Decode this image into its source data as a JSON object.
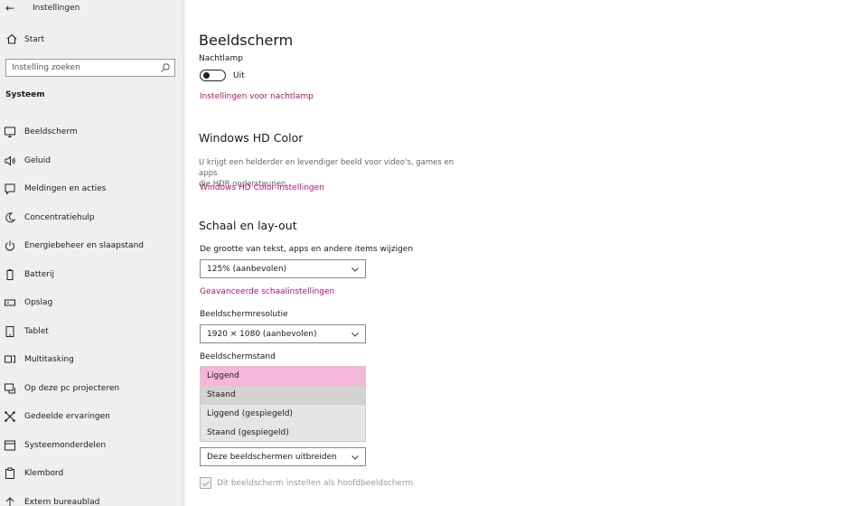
{
  "window": {
    "title": "Instellingen"
  },
  "sidebar": {
    "home_label": "Start",
    "search_placeholder": "Instelling zoeken",
    "section": "Systeem",
    "items": [
      {
        "label": "Beeldscherm",
        "icon": "monitor-icon"
      },
      {
        "label": "Geluid",
        "icon": "speaker-icon"
      },
      {
        "label": "Meldingen en acties",
        "icon": "notification-icon"
      },
      {
        "label": "Concentratiehulp",
        "icon": "moon-icon"
      },
      {
        "label": "Energiebeheer en slaapstand",
        "icon": "power-icon"
      },
      {
        "label": "Batterij",
        "icon": "battery-icon"
      },
      {
        "label": "Opslag",
        "icon": "storage-icon"
      },
      {
        "label": "Tablet",
        "icon": "tablet-icon"
      },
      {
        "label": "Multitasking",
        "icon": "multitasking-icon"
      },
      {
        "label": "Op deze pc projecteren",
        "icon": "project-icon"
      },
      {
        "label": "Gedeelde ervaringen",
        "icon": "shared-icon"
      },
      {
        "label": "Systeemonderdelen",
        "icon": "components-icon"
      },
      {
        "label": "Klembord",
        "icon": "clipboard-icon"
      },
      {
        "label": "Extern bureaublad",
        "icon": "remote-desktop-icon"
      }
    ]
  },
  "main": {
    "title": "Beeldscherm",
    "nightlight": {
      "label": "Nachtlamp",
      "state": "Uit",
      "link": "Instellingen voor nachtlamp"
    },
    "hdr": {
      "heading": "Windows HD Color",
      "desc_line1": "U krijgt een helderder en levendiger beeld voor video's, games en apps",
      "desc_line2": "die HDR ondersteunen.",
      "link": "Windows HD Color-instellingen"
    },
    "scale": {
      "heading": "Schaal en lay-out",
      "size_label": "De grootte van tekst, apps en andere items wijzigen",
      "size_value": "125% (aanbevolen)",
      "advanced_link": "Geavanceerde schaalinstellingen",
      "resolution_label": "Beeldschermresolutie",
      "resolution_value": "1920 × 1080 (aanbevolen)",
      "orientation_label": "Beeldschermstand",
      "orientation_options": [
        "Liggend",
        "Staand",
        "Liggend (gespiegeld)",
        "Staand (gespiegeld)"
      ],
      "orientation_selected": "Liggend"
    },
    "multi": {
      "value": "Deze beeldschermen uitbreiden",
      "main_display_label": "Dit beeldscherm instellen als hoofdbeeldscherm"
    }
  },
  "colors": {
    "accent": "#b5126a",
    "selected": "#f8b5da",
    "sidebar_bg": "#efefef"
  }
}
